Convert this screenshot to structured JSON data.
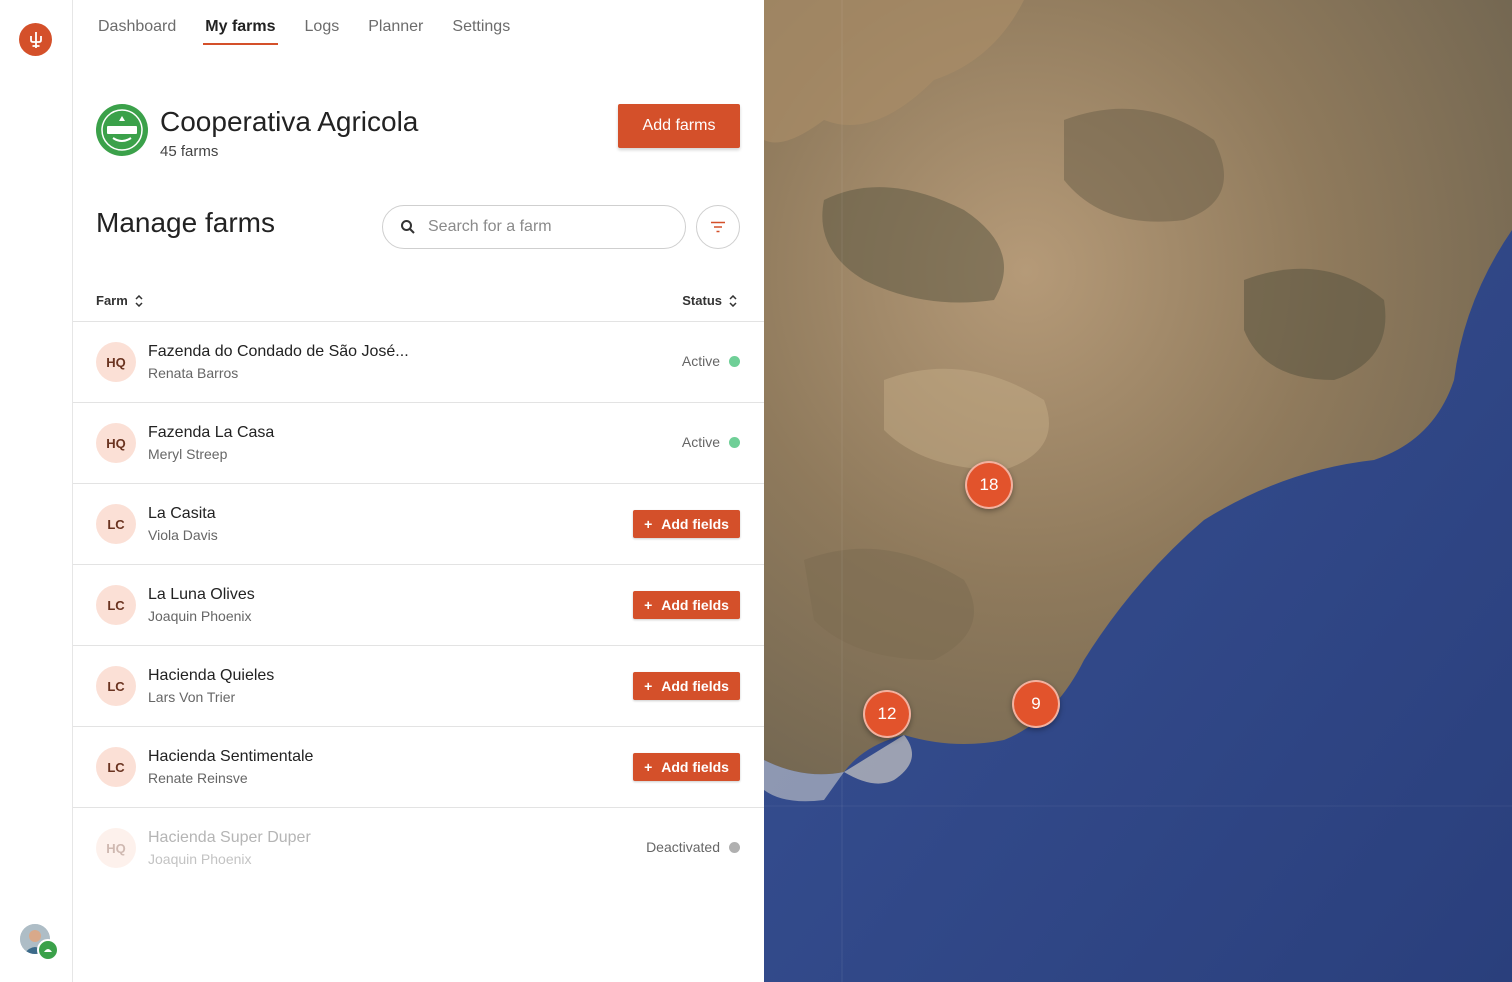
{
  "nav": {
    "items": [
      {
        "label": "Dashboard",
        "active": false
      },
      {
        "label": "My farms",
        "active": true
      },
      {
        "label": "Logs",
        "active": false
      },
      {
        "label": "Planner",
        "active": false
      },
      {
        "label": "Settings",
        "active": false
      }
    ]
  },
  "org": {
    "name": "Cooperativa Agricola",
    "farm_count": "45 farms",
    "add_button": "Add farms"
  },
  "manage": {
    "title": "Manage farms",
    "search_placeholder": "Search for a farm"
  },
  "table": {
    "col_farm": "Farm",
    "col_status": "Status",
    "add_fields_label": "Add fields",
    "rows": [
      {
        "initials": "HQ",
        "name": "Fazenda do Condado de São José...",
        "owner": "Renata Barros",
        "status": "Active",
        "type": "status"
      },
      {
        "initials": "HQ",
        "name": "Fazenda La Casa",
        "owner": "Meryl Streep",
        "status": "Active",
        "type": "status"
      },
      {
        "initials": "LC",
        "name": "La Casita",
        "owner": "Viola Davis",
        "status": "",
        "type": "add"
      },
      {
        "initials": "LC",
        "name": "La Luna Olives",
        "owner": "Joaquin Phoenix",
        "status": "",
        "type": "add"
      },
      {
        "initials": "LC",
        "name": "Hacienda Quieles",
        "owner": "Lars Von Trier",
        "status": "",
        "type": "add"
      },
      {
        "initials": "LC",
        "name": "Hacienda Sentimentale",
        "owner": "Renate Reinsve",
        "status": "",
        "type": "add"
      },
      {
        "initials": "HQ",
        "name": "Hacienda Super Duper",
        "owner": "Joaquin Phoenix",
        "status": "Deactivated",
        "type": "deactivated"
      }
    ]
  },
  "map": {
    "clusters": [
      {
        "count": "18"
      },
      {
        "count": "12"
      },
      {
        "count": "9"
      }
    ]
  },
  "colors": {
    "accent": "#d4502a",
    "active": "#6fcf97",
    "deactivated": "#b0b0b0",
    "org_green": "#3ba14a"
  }
}
